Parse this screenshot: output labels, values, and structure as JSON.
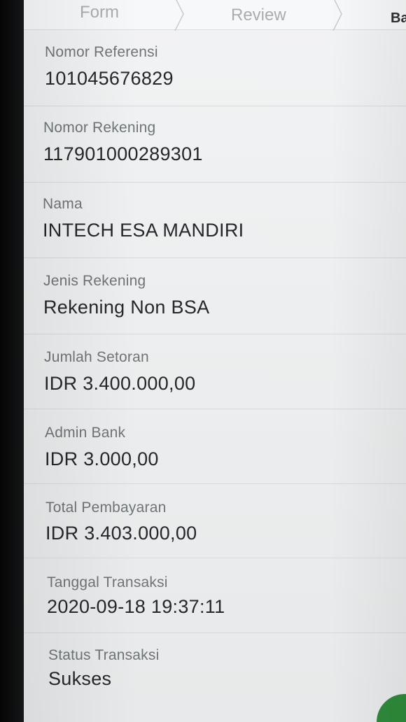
{
  "stepper": {
    "steps": [
      "Form",
      "Review",
      "Ba"
    ]
  },
  "details": [
    {
      "label": "Nomor Referensi",
      "value": "101045676829"
    },
    {
      "label": "Nomor Rekening",
      "value": "117901000289301"
    },
    {
      "label": "Nama",
      "value": "INTECH ESA MANDIRI"
    },
    {
      "label": "Jenis Rekening",
      "value": "Rekening Non BSA"
    },
    {
      "label": "Jumlah Setoran",
      "value": "IDR 3.400.000,00"
    },
    {
      "label": "Admin Bank",
      "value": "IDR 3.000,00"
    },
    {
      "label": "Total Pembayaran",
      "value": "IDR 3.403.000,00"
    },
    {
      "label": "Tanggal Transaksi",
      "value": "2020-09-18 19:37:11"
    },
    {
      "label": "Status Transaksi",
      "value": "Sukses"
    }
  ],
  "colors": {
    "accent": "#2e8a3a"
  },
  "icons": {
    "step_separator": "chevron-right-icon"
  }
}
